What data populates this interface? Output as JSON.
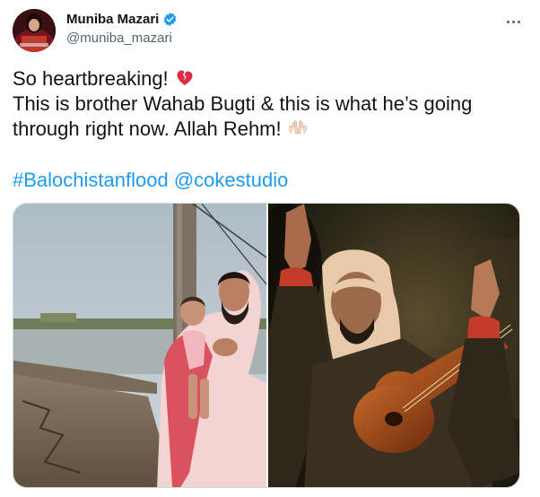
{
  "author": {
    "display_name": "Muniba Mazari",
    "handle": "@muniba_mazari",
    "verified": true,
    "avatar_icon": "avatar-photo"
  },
  "more_icon": "more-options-icon",
  "tweet": {
    "line1": "So heartbreaking!",
    "line1_emoji": "broken-heart-emoji",
    "line2": "This is brother Wahab Bugti & this is what he’s going",
    "line3": "through right now. Allah Rehm!",
    "line3_emoji": "praying-hands-emoji",
    "hashtag": "#Balochistanflood",
    "mention": "@cokestudio"
  },
  "media": {
    "photos": [
      {
        "name": "man-holding-child-in-flood-photo"
      },
      {
        "name": "musician-playing-instrument-photo"
      }
    ]
  },
  "colors": {
    "link": "#1d9bf0",
    "text": "#0f1419",
    "secondary": "#536471",
    "verified": "#1d9bf0"
  }
}
